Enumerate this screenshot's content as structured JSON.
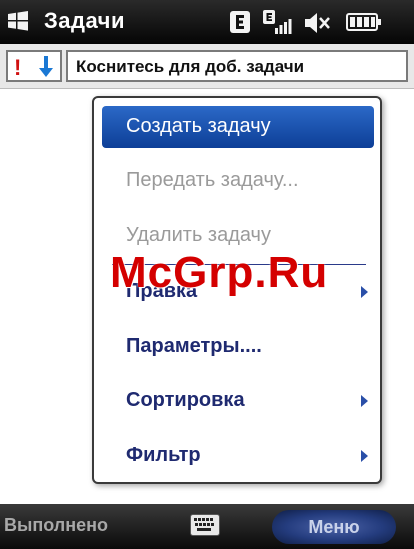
{
  "titlebar": {
    "app_title": "Задачи",
    "icons": [
      "windows-logo-icon",
      "edge-network-icon",
      "edge-signal-icon",
      "volume-muted-icon",
      "battery-icon"
    ]
  },
  "new_task": {
    "placeholder": "Коснитесь для доб. задачи",
    "priority_high_glyph": "!",
    "priority_low_icon": "down-arrow-icon"
  },
  "menu": {
    "items": [
      {
        "label": "Создать задачу",
        "state": "selected"
      },
      {
        "label": "Передать задачу...",
        "state": "disabled"
      },
      {
        "label": "Удалить задачу",
        "state": "disabled"
      },
      {
        "label": "Правка",
        "state": "submenu"
      },
      {
        "label": "Параметры....",
        "state": "enabled"
      },
      {
        "label": "Сортировка",
        "state": "submenu"
      },
      {
        "label": "Фильтр",
        "state": "submenu"
      }
    ]
  },
  "watermark": "McGrp.Ru",
  "softkeys": {
    "left": "Выполнено",
    "keyboard_icon": "keyboard-icon",
    "right": "Меню"
  },
  "colors": {
    "selection": "#1a4fb0",
    "menu_text": "#1f2a70",
    "disabled_text": "#9a9a9a",
    "watermark": "#d40000"
  }
}
